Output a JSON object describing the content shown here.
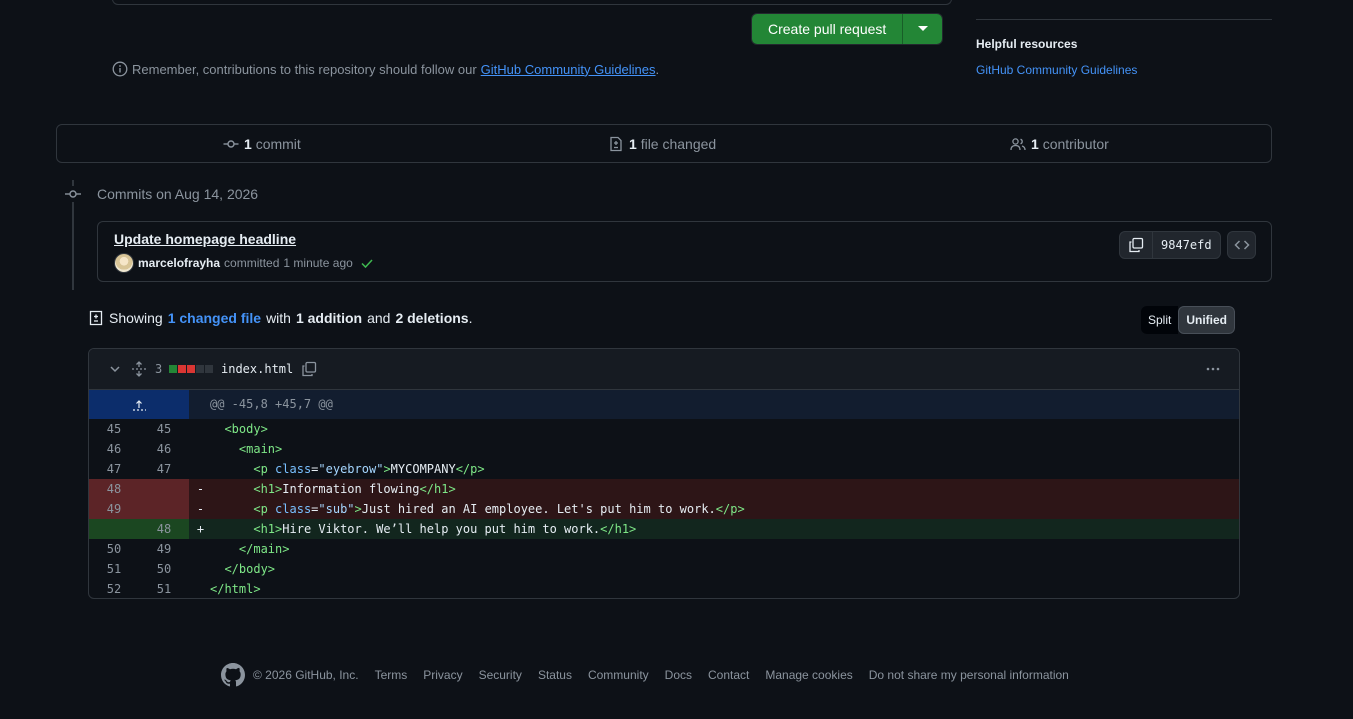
{
  "compare": {
    "create_pr_label": "Create pull request",
    "remember_text": "Remember, contributions to this repository should follow our",
    "guidelines_link": "GitHub Community Guidelines",
    "period": "."
  },
  "sidebar": {
    "helpful_title": "Helpful resources",
    "helpful_link": "GitHub Community Guidelines"
  },
  "stats": {
    "commits_count": "1",
    "commits_label": "commit",
    "files_count": "1",
    "files_label": "file changed",
    "contributors_count": "1",
    "contributors_label": "contributor"
  },
  "timeline": {
    "commits_on": "Commits on Aug 14, 2026",
    "commit": {
      "title": "Update homepage headline",
      "author": "marcelofrayha",
      "action": "committed",
      "time": "1 minute ago",
      "sha": "9847efd"
    }
  },
  "summary": {
    "showing": "Showing",
    "changed_files": "1 changed file",
    "with": "with",
    "additions": "1 addition",
    "and": "and",
    "deletions": "2 deletions",
    "end": ".",
    "split_label": "Split",
    "unified_label": "Unified"
  },
  "diff": {
    "changes_count": "3",
    "file_name": "index.html",
    "hunk_header": "@@ -45,8 +45,7 @@",
    "lines": [
      {
        "type": "ctx",
        "old": "45",
        "new": "45",
        "sign": "",
        "indent": "  ",
        "html": [
          [
            "t",
            "<body>"
          ]
        ]
      },
      {
        "type": "ctx",
        "old": "46",
        "new": "46",
        "sign": "",
        "indent": "    ",
        "html": [
          [
            "t",
            "<main>"
          ]
        ]
      },
      {
        "type": "ctx",
        "old": "47",
        "new": "47",
        "sign": "",
        "indent": "      ",
        "html": [
          [
            "t",
            "<p"
          ],
          [
            "x",
            " "
          ],
          [
            "a",
            "class"
          ],
          [
            "x",
            "="
          ],
          [
            "s",
            "\"eyebrow\""
          ],
          [
            "t",
            ">"
          ],
          [
            "x",
            "MYCOMPANY"
          ],
          [
            "t",
            "</p>"
          ]
        ]
      },
      {
        "type": "del",
        "old": "48",
        "new": "",
        "sign": "-",
        "indent": "      ",
        "html": [
          [
            "t",
            "<h1>"
          ],
          [
            "x",
            "Information flowing"
          ],
          [
            "t",
            "</h1>"
          ]
        ]
      },
      {
        "type": "del",
        "old": "49",
        "new": "",
        "sign": "-",
        "indent": "      ",
        "html": [
          [
            "t",
            "<p"
          ],
          [
            "x",
            " "
          ],
          [
            "a",
            "class"
          ],
          [
            "x",
            "="
          ],
          [
            "s",
            "\"sub\""
          ],
          [
            "t",
            ">"
          ],
          [
            "x",
            "Just hired an AI employee. Let's put him to work."
          ],
          [
            "t",
            "</p>"
          ]
        ]
      },
      {
        "type": "add",
        "old": "",
        "new": "48",
        "sign": "+",
        "indent": "      ",
        "html": [
          [
            "t",
            "<h1>"
          ],
          [
            "x",
            "Hire Viktor. We’ll help you put him to work."
          ],
          [
            "t",
            "</h1>"
          ]
        ]
      },
      {
        "type": "ctx",
        "old": "50",
        "new": "49",
        "sign": "",
        "indent": "    ",
        "html": [
          [
            "t",
            "</main>"
          ]
        ]
      },
      {
        "type": "ctx",
        "old": "51",
        "new": "50",
        "sign": "",
        "indent": "  ",
        "html": [
          [
            "t",
            "</body>"
          ]
        ]
      },
      {
        "type": "ctx",
        "old": "52",
        "new": "51",
        "sign": "",
        "indent": "",
        "html": [
          [
            "t",
            "</html>"
          ]
        ]
      }
    ]
  },
  "footer": {
    "copyright": "© 2026 GitHub, Inc.",
    "links": [
      "Terms",
      "Privacy",
      "Security",
      "Status",
      "Community",
      "Docs",
      "Contact",
      "Manage cookies",
      "Do not share my personal information"
    ]
  },
  "colors": {
    "primary_button": "#238636",
    "link": "#4493f8",
    "added": "#3fb950",
    "deleted": "#f85149"
  }
}
